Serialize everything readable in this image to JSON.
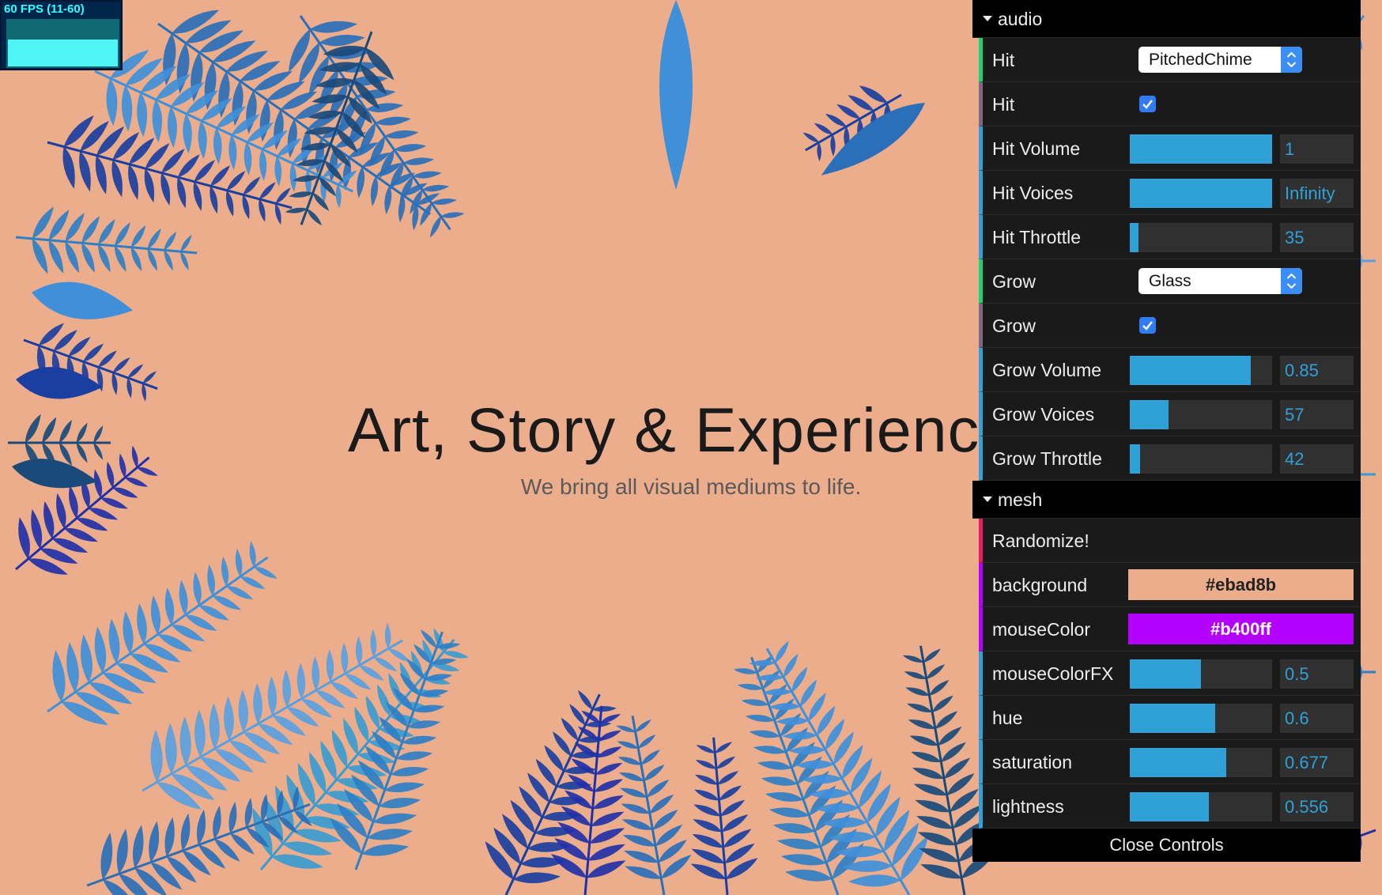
{
  "stats": {
    "fps_text": "60 FPS (11-60)"
  },
  "hero": {
    "title": "Art, Story & Experienc",
    "subtitle": "We bring all visual mediums to life."
  },
  "gui": {
    "folders": [
      {
        "name": "audio",
        "rows": [
          {
            "label": "Hit",
            "type": "select",
            "value": "PitchedChime"
          },
          {
            "label": "Hit",
            "type": "checkbox",
            "checked": true
          },
          {
            "label": "Hit Volume",
            "type": "slider",
            "value": "1",
            "fill": 1.0
          },
          {
            "label": "Hit Voices",
            "type": "slider",
            "value": "Infinity",
            "fill": 1.0
          },
          {
            "label": "Hit Throttle",
            "type": "slider",
            "value": "35",
            "fill": 0.06
          },
          {
            "label": "Grow",
            "type": "select",
            "value": "Glass"
          },
          {
            "label": "Grow",
            "type": "checkbox",
            "checked": true
          },
          {
            "label": "Grow Volume",
            "type": "slider",
            "value": "0.85",
            "fill": 0.85
          },
          {
            "label": "Grow Voices",
            "type": "slider",
            "value": "57",
            "fill": 0.27
          },
          {
            "label": "Grow Throttle",
            "type": "slider",
            "value": "42",
            "fill": 0.07
          }
        ]
      },
      {
        "name": "mesh",
        "rows": [
          {
            "label": "Randomize!",
            "type": "function"
          },
          {
            "label": "background",
            "type": "color",
            "value": "#ebad8b",
            "color": "#ebad8b",
            "text_color": "#222222"
          },
          {
            "label": "mouseColor",
            "type": "color",
            "value": "#b400ff",
            "color": "#b400ff",
            "text_color": "#ffffff"
          },
          {
            "label": "mouseColorFX",
            "type": "slider",
            "value": "0.5",
            "fill": 0.5
          },
          {
            "label": "hue",
            "type": "slider",
            "value": "0.6",
            "fill": 0.6
          },
          {
            "label": "saturation",
            "type": "slider",
            "value": "0.677",
            "fill": 0.677
          },
          {
            "label": "lightness",
            "type": "slider",
            "value": "0.556",
            "fill": 0.556
          }
        ]
      }
    ],
    "close_label": "Close Controls"
  },
  "colors": {
    "background": "#ebad8b",
    "slider_accent": "#2fa1d6",
    "leaf_palette": [
      "#2a6fb8",
      "#3f8fd9",
      "#1b3fa0",
      "#2f7fc4",
      "#5aa0e0",
      "#1a4a7a",
      "#3a9bd0",
      "#2230a8"
    ]
  }
}
